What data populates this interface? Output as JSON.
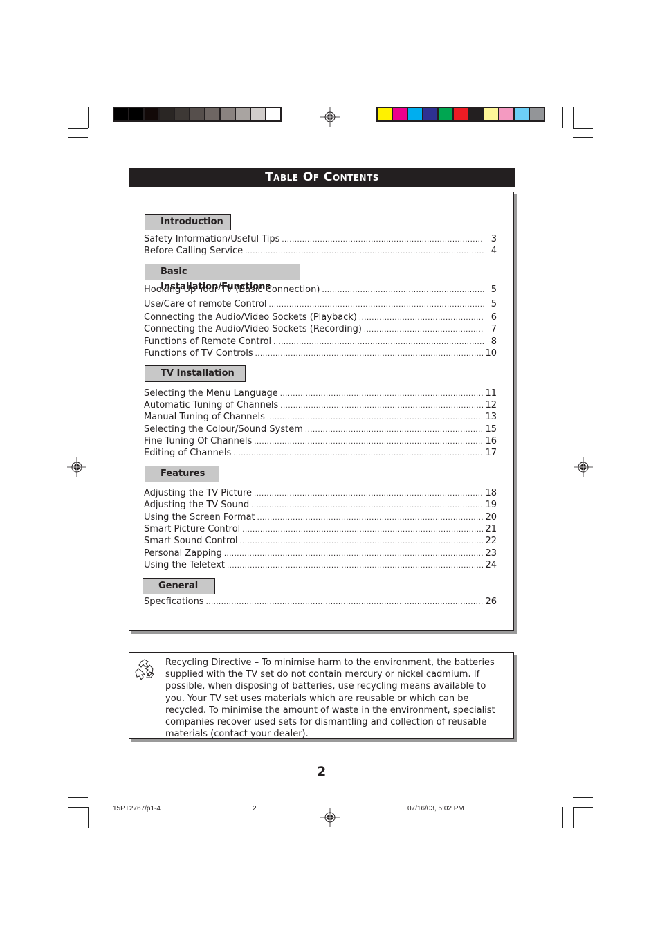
{
  "colors": {
    "grayscale_bar": [
      "#000000",
      "#000000",
      "#120908",
      "#2a2624",
      "#3d3835",
      "#564f4c",
      "#6e6663",
      "#8a8380",
      "#a9a4a1",
      "#d1cdcb",
      "#ffffff"
    ],
    "color_bar": [
      "#fff100",
      "#ec008c",
      "#00aeef",
      "#2e3192",
      "#00a651",
      "#ed1c24",
      "#231f20",
      "#fff799",
      "#f49ac1",
      "#6dcff6",
      "#939598"
    ],
    "banner_bg": "#231f20",
    "section_label_bg": "#c8c8c8",
    "shadow": "#9a9a9a"
  },
  "title": "Table Of Contents",
  "sections": [
    {
      "label": "Introduction",
      "entries": [
        {
          "title": "Safety Information/Useful Tips",
          "page": "3"
        },
        {
          "title": "Before Calling Service",
          "page": "4"
        }
      ]
    },
    {
      "label": "Basic Installation/Functions",
      "entries": [
        {
          "title": "Hooking Up Your TV (Basic Connection)",
          "page": "5"
        },
        {
          "title": "Use/Care of remote Control",
          "page": "5"
        },
        {
          "title": "Connecting the Audio/Video Sockets (Playback)",
          "page": "6"
        },
        {
          "title": "Connecting the Audio/Video Sockets (Recording)",
          "page": "7"
        },
        {
          "title": "Functions of Remote Control",
          "page": "8"
        },
        {
          "title": "Functions of  TV Controls",
          "page": "10"
        }
      ]
    },
    {
      "label": "TV Installation",
      "entries": [
        {
          "title": "Selecting the Menu Language",
          "page": "11"
        },
        {
          "title": "Automatic Tuning of Channels",
          "page": "12"
        },
        {
          "title": "Manual Tuning of Channels",
          "page": "13"
        },
        {
          "title": "Selecting the Colour/Sound System",
          "page": "15"
        },
        {
          "title": "Fine Tuning Of Channels",
          "page": "16"
        },
        {
          "title": "Editing of Channels",
          "page": "17"
        }
      ]
    },
    {
      "label": "Features",
      "entries": [
        {
          "title": "Adjusting the TV Picture",
          "page": "18"
        },
        {
          "title": "Adjusting the TV Sound",
          "page": "19"
        },
        {
          "title": "Using the Screen Format",
          "page": "20"
        },
        {
          "title": "Smart Picture Control",
          "page": "21"
        },
        {
          "title": "Smart Sound Control",
          "page": "22"
        },
        {
          "title": "Personal Zapping",
          "page": "23"
        },
        {
          "title": "Using the Teletext",
          "page": "24"
        }
      ]
    },
    {
      "label": "General",
      "entries": [
        {
          "title": "Specfications",
          "page": "26"
        }
      ]
    }
  ],
  "recycling_note": {
    "icon": "recycle-icon",
    "text": "Recycling Directive –  To minimise harm to the environment, the batteries supplied with the TV set do not contain mercury or nickel cadmium.  If possible, when disposing of batteries, use recycling means available to you. Your TV set uses materials which are reusable or which can be recycled. To minimise the amount of waste in the environment, specialist companies recover used sets for dismantling and collection of reusable materials (contact your dealer)."
  },
  "page_number": "2",
  "slug": {
    "file": "15PT2767/p1-4",
    "page": "2",
    "timestamp": "07/16/03, 5:02 PM"
  }
}
